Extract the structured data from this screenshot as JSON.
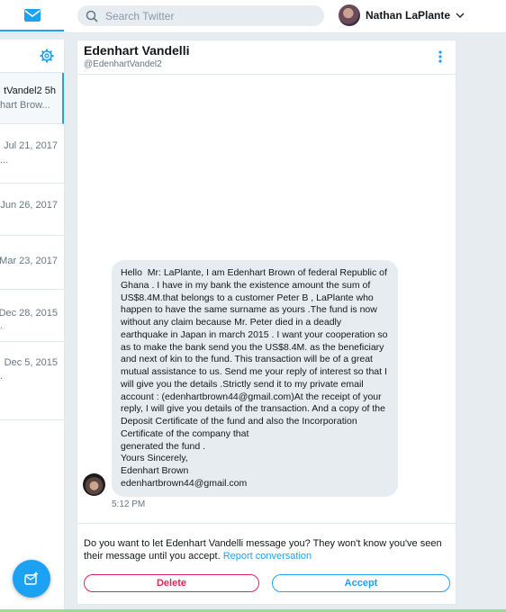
{
  "search": {
    "placeholder": "Search Twitter"
  },
  "user": {
    "name": "Nathan LaPlante"
  },
  "conversations": [
    {
      "line1": "tVandel2   5h",
      "line2": "hart Brow..."
    },
    {
      "date": "Jul 21, 2017",
      "snippet": "..."
    },
    {
      "date": "Jun 26, 2017",
      "snippet": ""
    },
    {
      "date": "Mar 23, 2017",
      "snippet": ""
    },
    {
      "date": "Dec 28, 2015",
      "snippet": "."
    },
    {
      "date": "Dec 5, 2015",
      "snippet": "."
    }
  ],
  "thread": {
    "name": "Edenhart Vandelli",
    "handle": "@EdenhartVandel2",
    "message": "Hello  Mr: LaPlante, I am Edenhart Brown of federal Republic of Ghana . I have in my bank the existence amount the sum of US$8.4M.that belongs to a customer Peter B , LaPlante who happen to have the same surname as yours .The fund is now without any claim because Mr. Peter died in a deadly earthquake in Japan in march 2015 . I want your cooperation so as to make the bank send you the US$8.4M. as the beneficiary and next of kin to the fund. This transaction will be of a great mutual assistance to us. Send me your reply of interest so that I will give you the details .Strictly send it to my private email account : (edenhartbrown44@gmail.com)At the receipt of your reply, I will give you details of the transaction. And a copy of the Deposit Certificate of the fund and also the Incorporation Certificate of the company that\ngenerated the fund .\nYours Sincerely,\nEdenhart Brown\nedenhartbrown44@gmail.com",
    "time": "5:12 PM"
  },
  "request": {
    "text": "Do you want to let Edenhart Vandelli message you? They won't know you've seen their message until you accept.",
    "report_link": "Report conversation",
    "delete_label": "Delete",
    "accept_label": "Accept"
  },
  "colors": {
    "accent": "#1da1f2",
    "danger": "#e0245e",
    "background": "#e6ecf0"
  }
}
